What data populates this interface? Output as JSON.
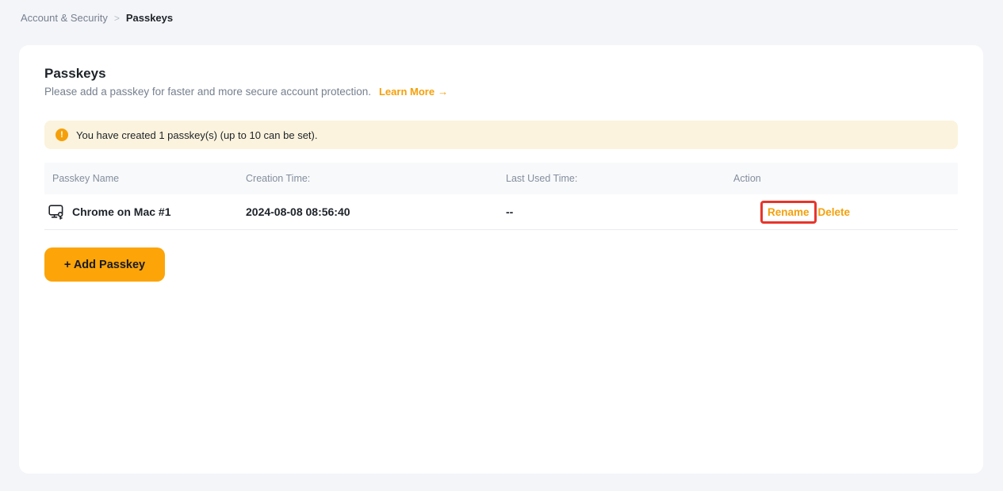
{
  "breadcrumb": {
    "parent": "Account & Security",
    "separator": ">",
    "current": "Passkeys"
  },
  "header": {
    "title": "Passkeys",
    "subtitle": "Please add a passkey for faster and more secure account protection.",
    "learn_more_label": "Learn More",
    "learn_more_arrow": "→"
  },
  "banner": {
    "icon": "warning-exclamation-icon",
    "icon_glyph": "!",
    "text": "You have created 1 passkey(s) (up to 10 can be set)."
  },
  "table": {
    "headers": [
      "Passkey Name",
      "Creation Time:",
      "Last Used Time:",
      "Action"
    ],
    "rows": [
      {
        "icon": "passkey-device-icon",
        "name": "Chrome on Mac #1",
        "creation_time": "2024-08-08 08:56:40",
        "last_used": "--",
        "actions": [
          "Rename",
          "Delete"
        ]
      }
    ]
  },
  "actions": {
    "add_passkey_label": "+ Add Passkey"
  },
  "colors": {
    "accent_orange": "#FCA408",
    "link_orange": "#F5A00A",
    "banner_bg": "#FBF3DD",
    "annotation_red": "#E8352B",
    "page_bg": "#F4F5F9",
    "text_dark": "#1E2329",
    "text_gray": "#76808F"
  }
}
